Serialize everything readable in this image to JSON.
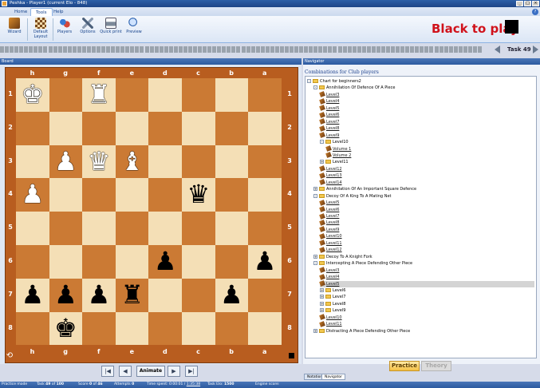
{
  "window": {
    "title": "Peshka - Player1 (current Elo - 848)"
  },
  "ribbon": {
    "tabs": [
      "Home",
      "Tools",
      "Help"
    ],
    "buttons": [
      {
        "label": "Wizard",
        "icon": "wand-icon"
      },
      {
        "label": "Default Layout",
        "icon": "layout-icon"
      },
      {
        "label": "Players",
        "icon": "players-icon"
      },
      {
        "label": "Options",
        "icon": "options-icon"
      },
      {
        "label": "Quick print",
        "icon": "printer-icon"
      },
      {
        "label": "Preview",
        "icon": "preview-icon"
      }
    ]
  },
  "status": {
    "turn_text": "Black to play",
    "task_label": "Task 49"
  },
  "board": {
    "header": "Board",
    "files": [
      "h",
      "g",
      "f",
      "e",
      "d",
      "c",
      "b",
      "a"
    ],
    "ranks": [
      "1",
      "2",
      "3",
      "4",
      "5",
      "6",
      "7",
      "8"
    ],
    "pieces": [
      {
        "sq": "h1",
        "glyph": "♚",
        "color": "w"
      },
      {
        "sq": "f1",
        "glyph": "♜",
        "color": "w"
      },
      {
        "sq": "g3",
        "glyph": "♟",
        "color": "w"
      },
      {
        "sq": "f3",
        "glyph": "♛",
        "color": "w"
      },
      {
        "sq": "e3",
        "glyph": "♝",
        "color": "w"
      },
      {
        "sq": "h4",
        "glyph": "♟",
        "color": "w"
      },
      {
        "sq": "c4",
        "glyph": "♛",
        "color": "b"
      },
      {
        "sq": "d6",
        "glyph": "♟",
        "color": "b"
      },
      {
        "sq": "a6",
        "glyph": "♟",
        "color": "b"
      },
      {
        "sq": "h7",
        "glyph": "♟",
        "color": "b"
      },
      {
        "sq": "g7",
        "glyph": "♟",
        "color": "b"
      },
      {
        "sq": "f7",
        "glyph": "♟",
        "color": "b"
      },
      {
        "sq": "e7",
        "glyph": "♜",
        "color": "b"
      },
      {
        "sq": "b7",
        "glyph": "♟",
        "color": "b"
      },
      {
        "sq": "g8",
        "glyph": "♚",
        "color": "b"
      }
    ]
  },
  "controls": {
    "animate_label": "Animate"
  },
  "navigator": {
    "header": "Navigator",
    "title": "Combinations for Club players",
    "tree": [
      {
        "depth": 0,
        "kind": "folder",
        "exp": "-",
        "label": "Chart for beginners2"
      },
      {
        "depth": 1,
        "kind": "folder",
        "exp": "-",
        "label": "Annihilation Of Defence Of A Piece"
      },
      {
        "depth": 2,
        "kind": "task",
        "label": "Level3"
      },
      {
        "depth": 2,
        "kind": "task",
        "label": "Level4"
      },
      {
        "depth": 2,
        "kind": "task",
        "label": "Level5"
      },
      {
        "depth": 2,
        "kind": "task",
        "label": "Level6"
      },
      {
        "depth": 2,
        "kind": "task",
        "label": "Level7"
      },
      {
        "depth": 2,
        "kind": "task",
        "label": "Level8"
      },
      {
        "depth": 2,
        "kind": "task",
        "label": "Level9"
      },
      {
        "depth": 2,
        "kind": "folder",
        "exp": "-",
        "label": "Level10"
      },
      {
        "depth": 3,
        "kind": "task",
        "label": "Volume 1"
      },
      {
        "depth": 3,
        "kind": "task",
        "label": "Volume 2"
      },
      {
        "depth": 2,
        "kind": "folder",
        "exp": "+",
        "label": "Level11"
      },
      {
        "depth": 2,
        "kind": "task",
        "label": "Level12"
      },
      {
        "depth": 2,
        "kind": "task",
        "label": "Level13"
      },
      {
        "depth": 2,
        "kind": "task",
        "label": "Level14"
      },
      {
        "depth": 1,
        "kind": "folder",
        "exp": "+",
        "label": "Annihilation Of An Important Square Defence"
      },
      {
        "depth": 1,
        "kind": "folder",
        "exp": "-",
        "label": "Decoy Of A King To A Mating Net"
      },
      {
        "depth": 2,
        "kind": "task",
        "label": "Level5"
      },
      {
        "depth": 2,
        "kind": "task",
        "label": "Level6"
      },
      {
        "depth": 2,
        "kind": "task",
        "label": "Level7"
      },
      {
        "depth": 2,
        "kind": "task",
        "label": "Level8"
      },
      {
        "depth": 2,
        "kind": "task",
        "label": "Level9"
      },
      {
        "depth": 2,
        "kind": "task",
        "label": "Level10"
      },
      {
        "depth": 2,
        "kind": "task",
        "label": "Level11"
      },
      {
        "depth": 2,
        "kind": "task",
        "label": "Level12"
      },
      {
        "depth": 1,
        "kind": "folder",
        "exp": "+",
        "label": "Decoy To A Knight Fork"
      },
      {
        "depth": 1,
        "kind": "folder",
        "exp": "-",
        "label": "Intercepting A Piece Defending Other Piece"
      },
      {
        "depth": 2,
        "kind": "task",
        "label": "Level3"
      },
      {
        "depth": 2,
        "kind": "task",
        "label": "Level4"
      },
      {
        "depth": 2,
        "kind": "task",
        "label": "Level5",
        "selected": true
      },
      {
        "depth": 2,
        "kind": "folder",
        "exp": "+",
        "label": "Level6"
      },
      {
        "depth": 2,
        "kind": "folder",
        "exp": "+",
        "label": "Level7"
      },
      {
        "depth": 2,
        "kind": "folder",
        "exp": "+",
        "label": "Level8"
      },
      {
        "depth": 2,
        "kind": "folder",
        "exp": "+",
        "label": "Level9"
      },
      {
        "depth": 2,
        "kind": "task",
        "label": "Level10"
      },
      {
        "depth": 2,
        "kind": "task",
        "label": "Level11"
      },
      {
        "depth": 1,
        "kind": "folder",
        "exp": "+",
        "label": "Distracting A Piece Defending Other Piece"
      }
    ],
    "practice_label": "Practice",
    "theory_label": "Theory",
    "panel_tabs": [
      "Notation",
      "Navigator"
    ]
  },
  "statusbar": {
    "mode": "Practice mode",
    "task_prefix": "Task",
    "task_value": "49",
    "task_of": "of",
    "task_total": "100",
    "score_prefix": "Score",
    "score_value": "0",
    "score_of": "of",
    "score_total": "46",
    "attempts_prefix": "Attempts",
    "attempts_value": "0",
    "time_prefix": "Time spent:",
    "time_value": "0:00:01",
    "time_sep": "/",
    "time_link": "1:35:38",
    "elo_prefix": "Task Elo:",
    "elo_value": "1500",
    "engine_prefix": "Engine score:"
  }
}
